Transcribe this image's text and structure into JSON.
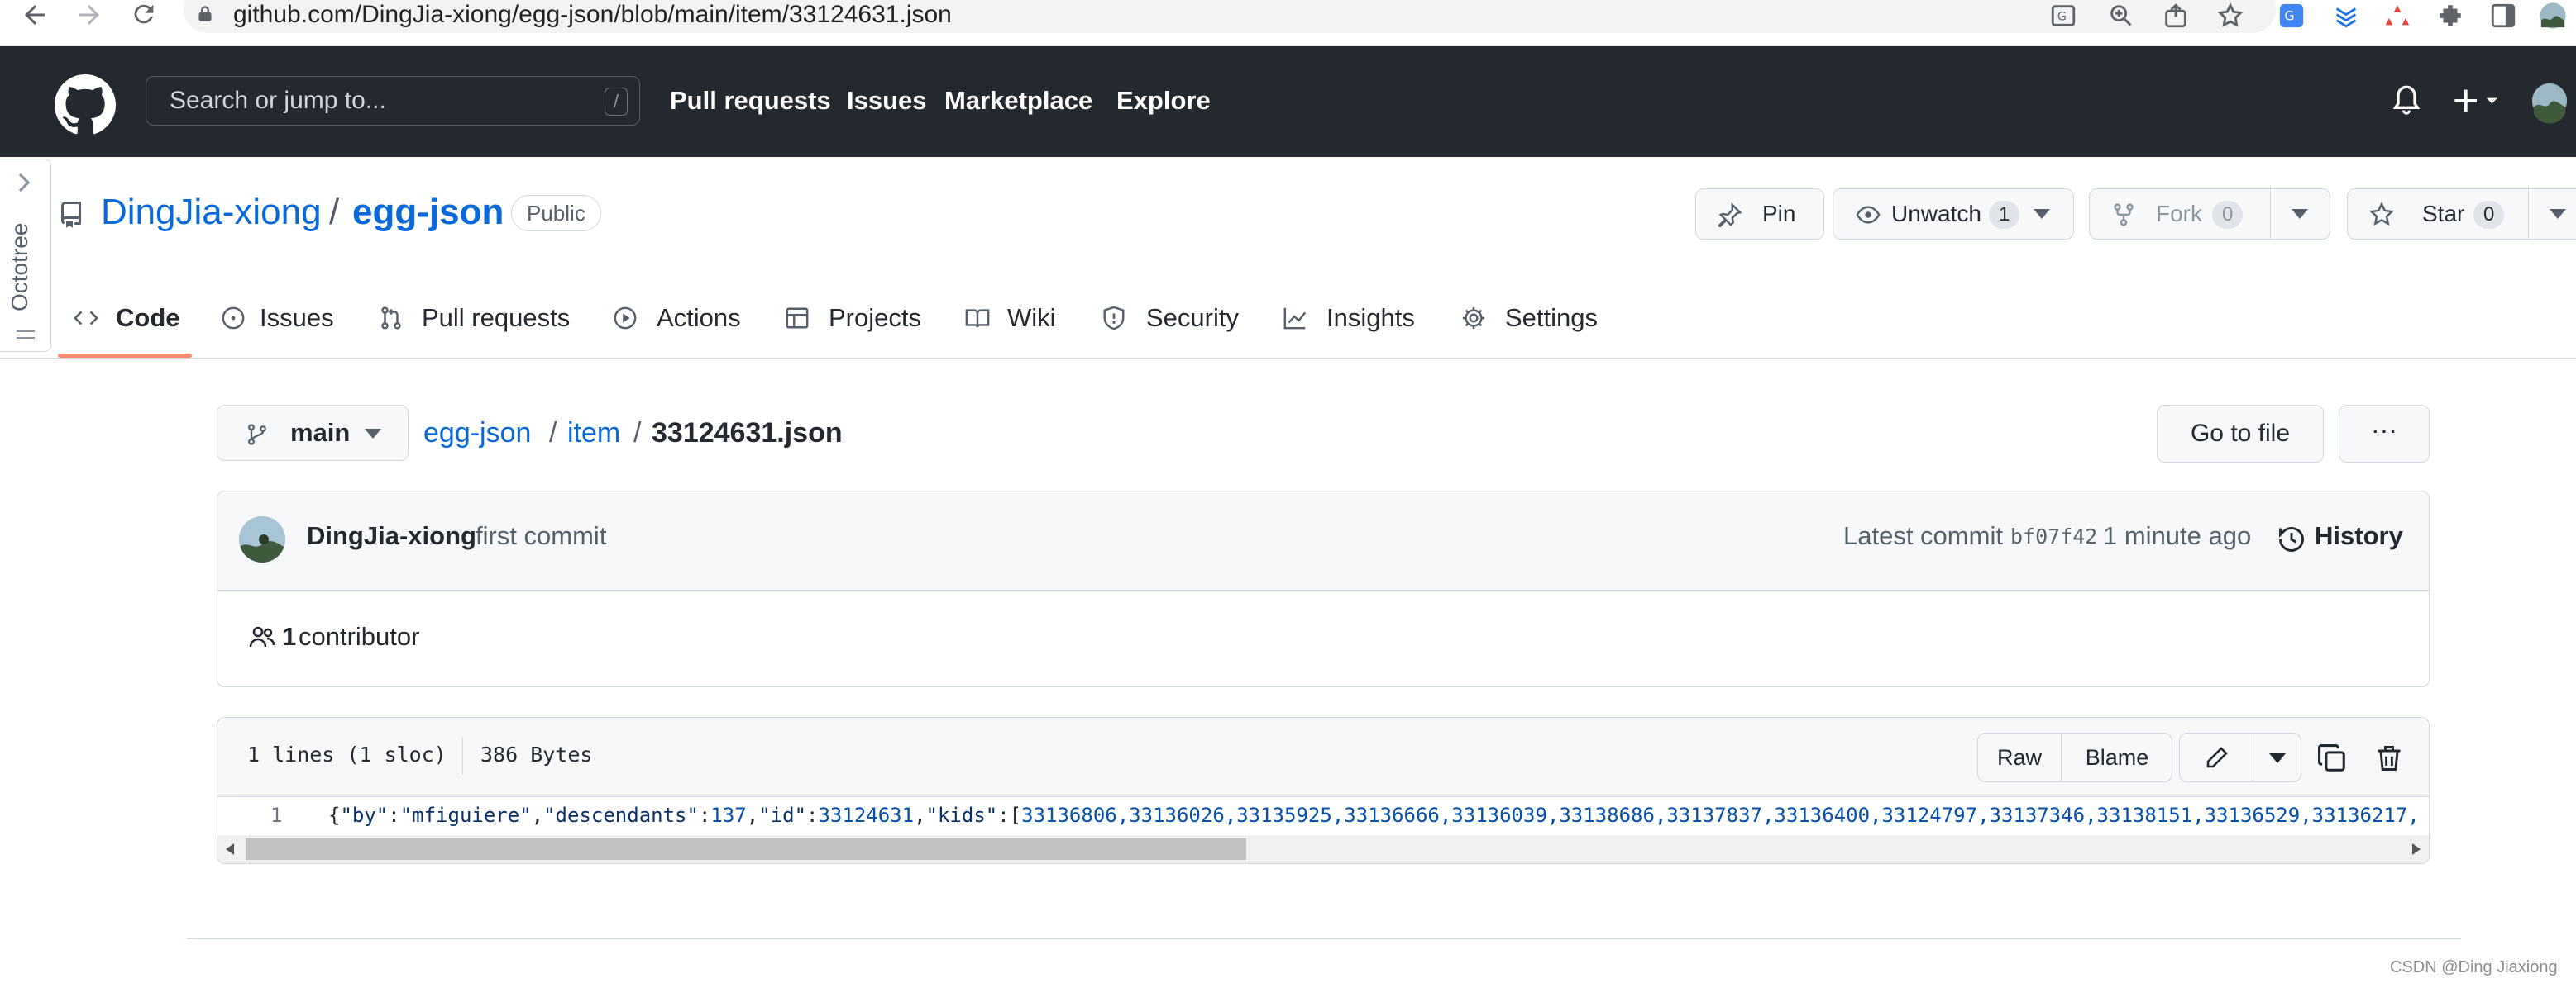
{
  "browser": {
    "url": "github.com/DingJia-xiong/egg-json/blob/main/item/33124631.json",
    "icons": [
      "back-icon",
      "forward-icon",
      "reload-icon",
      "lock-icon",
      "translate-icon",
      "zoom-icon",
      "share-icon",
      "bookmark-star-icon",
      "extension-icon",
      "puzzle-icon",
      "sidebar-icon",
      "profile-avatar"
    ]
  },
  "gh_header": {
    "search_placeholder": "Search or jump to...",
    "search_shortcut": "/",
    "nav": [
      "Pull requests",
      "Issues",
      "Marketplace",
      "Explore"
    ]
  },
  "octotree": {
    "label": "Octotree"
  },
  "repo": {
    "owner": "DingJia-xiong",
    "separator": "/",
    "name": "egg-json",
    "visibility": "Public",
    "pin_label": "Pin",
    "unwatch_label": "Unwatch",
    "unwatch_count": "1",
    "fork_label": "Fork",
    "fork_count": "0",
    "star_label": "Star",
    "star_count": "0"
  },
  "tabs": [
    {
      "label": "Code",
      "icon": "code-icon",
      "active": true
    },
    {
      "label": "Issues",
      "icon": "issue-icon"
    },
    {
      "label": "Pull requests",
      "icon": "pull-request-icon"
    },
    {
      "label": "Actions",
      "icon": "play-icon"
    },
    {
      "label": "Projects",
      "icon": "table-icon"
    },
    {
      "label": "Wiki",
      "icon": "book-icon"
    },
    {
      "label": "Security",
      "icon": "shield-icon"
    },
    {
      "label": "Insights",
      "icon": "graph-icon"
    },
    {
      "label": "Settings",
      "icon": "gear-icon"
    }
  ],
  "file_nav": {
    "branch": "main",
    "crumb_repo": "egg-json",
    "crumb_sep1": "/",
    "crumb_dir": "item",
    "crumb_sep2": "/",
    "crumb_file": "33124631.json",
    "go_to_file": "Go to file",
    "more": "···"
  },
  "commit": {
    "author": "DingJia-xiong",
    "message": "first commit",
    "latest_label": "Latest commit",
    "sha": "bf07f42",
    "time": "1 minute ago",
    "history_label": "History",
    "contributor_count": "1",
    "contributor_label": "contributor"
  },
  "file": {
    "lines_info": "1 lines (1 sloc)",
    "size": "386 Bytes",
    "raw_label": "Raw",
    "blame_label": "Blame",
    "line_number": "1",
    "code_parts": {
      "p1": "{",
      "k_by": "\"by\"",
      "c1": ":",
      "v_by": "\"mfiguiere\"",
      "c2": ",",
      "k_desc": "\"descendants\"",
      "c3": ":",
      "v_desc": "137",
      "c4": ",",
      "k_id": "\"id\"",
      "c5": ":",
      "v_id": "33124631",
      "c6": ",",
      "k_kids": "\"kids\"",
      "c7": ":[",
      "v_kids": "33136806,33136026,33135925,33136666,33136039,33138686,33137837,33136400,33124797,33137346,33138151,33136529,33136217,"
    },
    "scroll_position": 0.0
  },
  "footer": {
    "watermark": "CSDN @Ding Jiaxiong"
  }
}
